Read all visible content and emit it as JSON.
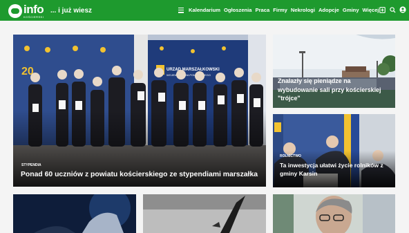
{
  "header": {
    "logo_main": "info",
    "logo_sub": "KOŚCIERSKI",
    "tagline": "... i już wiesz",
    "nav": [
      "Kalendarium",
      "Ogłoszenia",
      "Praca",
      "Firmy",
      "Nekrologi",
      "Adopcje",
      "Gminy",
      "Więcej"
    ]
  },
  "articles": {
    "main": {
      "tag": "STYPENDIA",
      "title": "Ponad 60 uczniów z powiatu kościerskiego ze stypendiami marszałka",
      "banner_left": "20",
      "banner_right": "URZĄD MARSZAŁKOWSKI",
      "banner_right_2": "WOJEWÓDZTWA POMORSKIEGO"
    },
    "side1": {
      "title": "Znalazły się pieniądze na wybudowanie sali przy kościerskiej \"trójce\""
    },
    "side2": {
      "tag": "ROLNICTWO",
      "title": "Ta inwestycja ułatwi życie rolników z gminy Karsin"
    }
  },
  "colors": {
    "brand": "#1e9a2e",
    "background": "#f4f4f4"
  },
  "icons": [
    "menu-icon",
    "add-box-icon",
    "search-icon",
    "account-icon"
  ]
}
